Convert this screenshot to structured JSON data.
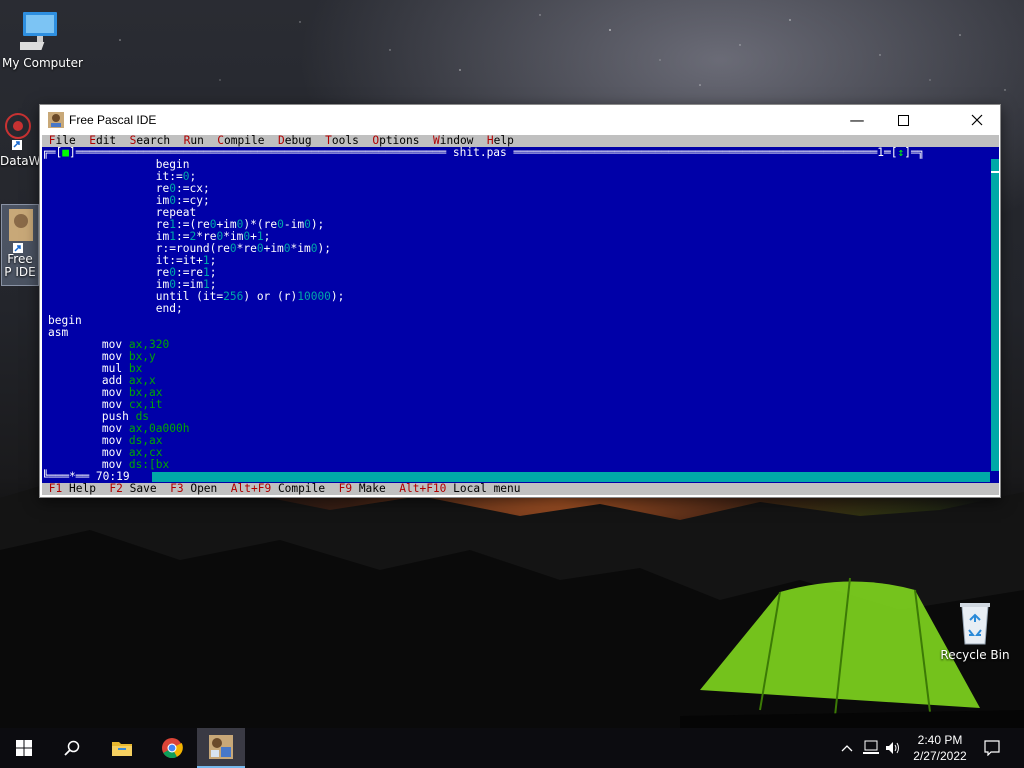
{
  "desktop": {
    "icons": [
      {
        "label": "My Computer"
      },
      {
        "label": "DataW"
      },
      {
        "label": "Free P IDE"
      },
      {
        "label": "Recycle Bin"
      }
    ]
  },
  "window": {
    "title": "Free Pascal IDE"
  },
  "ide": {
    "menu": [
      {
        "hot": "F",
        "rest": "ile"
      },
      {
        "hot": "E",
        "rest": "dit"
      },
      {
        "hot": "S",
        "rest": "earch"
      },
      {
        "hot": "R",
        "rest": "un"
      },
      {
        "hot": "C",
        "rest": "ompile"
      },
      {
        "hot": "D",
        "rest": "ebug"
      },
      {
        "hot": "T",
        "rest": "ools"
      },
      {
        "hot": "O",
        "rest": "ptions"
      },
      {
        "hot": "W",
        "rest": "indow"
      },
      {
        "hot": "H",
        "rest": "elp"
      }
    ],
    "editor": {
      "filename": "shit.pas",
      "window_number": "1",
      "close_glyph": "■",
      "zoom_glyph": "↕",
      "cursor_pos": "70:19",
      "lines": [
        "                begin",
        "                it:=0;",
        "                re0:=cx;",
        "                im0:=cy;",
        "                repeat",
        "                re1:=(re0+im0)*(re0-im0);",
        "                im1:=2*re0*im0+1;",
        "                r:=round(re0*re0+im0*im0);",
        "                it:=it+1;",
        "                re0:=re1;",
        "                im0:=im1;",
        "                until (it=256) or (r)10000);",
        "                end;",
        "begin",
        "asm",
        "        mov ax,320",
        "        mov bx,y",
        "        mul bx",
        "        add ax,x",
        "        mov bx,ax",
        "        mov cx,it",
        "        push ds",
        "        mov ax,0a000h",
        "        mov ds,ax",
        "        mov ax,cx",
        "        mov ds:[bx"
      ]
    },
    "status": [
      {
        "key": "F1",
        "label": "Help"
      },
      {
        "key": "F2",
        "label": "Save"
      },
      {
        "key": "F3",
        "label": "Open"
      },
      {
        "key": "Alt+F9",
        "label": "Compile"
      },
      {
        "key": "F9",
        "label": "Make"
      },
      {
        "key": "Alt+F10",
        "label": "Local menu"
      }
    ]
  },
  "taskbar": {
    "time": "2:40 PM",
    "date": "2/27/2022"
  },
  "colors": {
    "editor_bg": "#0000a8",
    "menu_bg": "#c0c0c0",
    "hotkey": "#b00000",
    "number": "#00a8a8",
    "asm_operand": "#00a800"
  }
}
